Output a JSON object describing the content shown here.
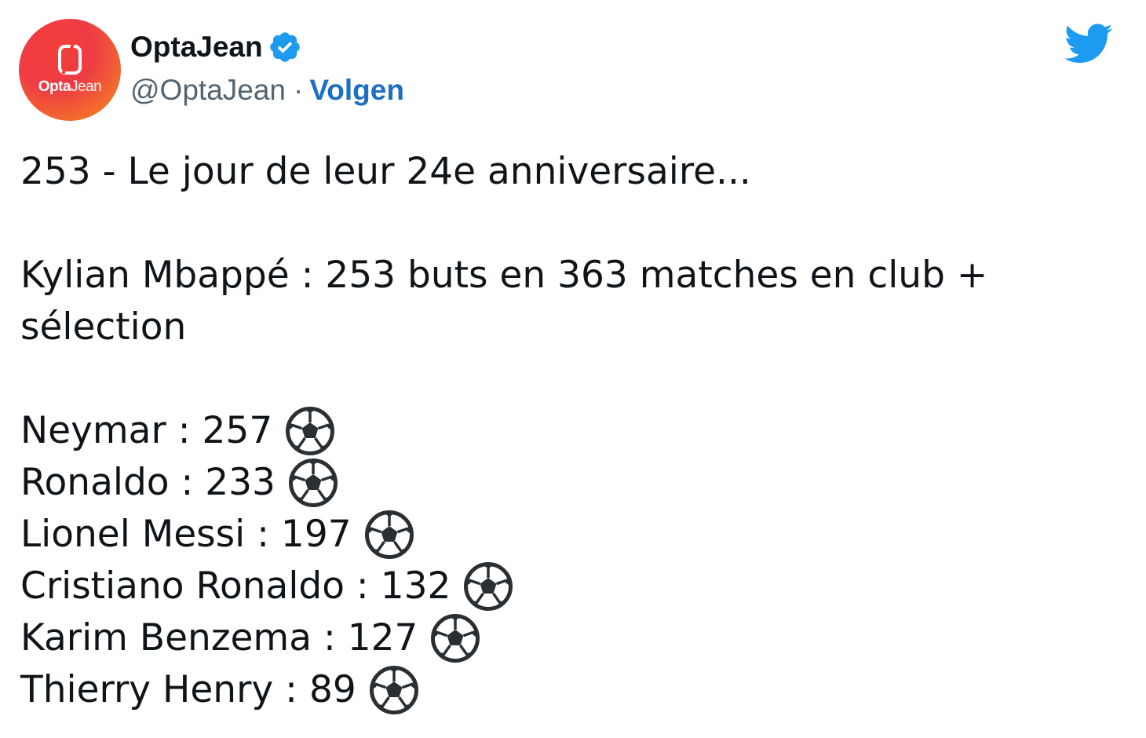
{
  "author": {
    "avatar_text_bold": "Opta",
    "avatar_text_light": "Jean",
    "display_name": "OptaJean",
    "handle": "@OptaJean",
    "separator": "·",
    "follow_label": "Volgen",
    "verified": true
  },
  "icons": {
    "verified": "verified-badge-icon",
    "platform": "twitter-bird-icon",
    "ball": "soccer-ball-icon"
  },
  "colors": {
    "twitter_blue": "#1d9bf0",
    "follow_blue": "#1d6ec5",
    "handle_gray": "#536471",
    "text": "#0f1419"
  },
  "tweet": {
    "intro": "253 - Le jour de leur 24e anniversaire...",
    "stat_line_1": "Kylian Mbappé : 253 buts en 363 matches en club +",
    "stat_line_2": "sélection",
    "players": [
      {
        "text": "Neymar : 257"
      },
      {
        "text": "Ronaldo : 233"
      },
      {
        "text": "Lionel Messi : 197"
      },
      {
        "text": "Cristiano Ronaldo : 132"
      },
      {
        "text": "Karim Benzema : 127"
      },
      {
        "text": "Thierry Henry : 89"
      }
    ]
  }
}
